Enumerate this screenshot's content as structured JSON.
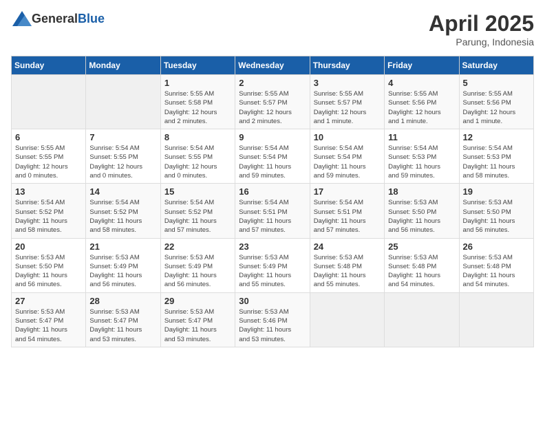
{
  "header": {
    "logo_general": "General",
    "logo_blue": "Blue",
    "title": "April 2025",
    "subtitle": "Parung, Indonesia"
  },
  "days_of_week": [
    "Sunday",
    "Monday",
    "Tuesday",
    "Wednesday",
    "Thursday",
    "Friday",
    "Saturday"
  ],
  "weeks": [
    [
      {
        "day": "",
        "detail": ""
      },
      {
        "day": "",
        "detail": ""
      },
      {
        "day": "1",
        "detail": "Sunrise: 5:55 AM\nSunset: 5:58 PM\nDaylight: 12 hours\nand 2 minutes."
      },
      {
        "day": "2",
        "detail": "Sunrise: 5:55 AM\nSunset: 5:57 PM\nDaylight: 12 hours\nand 2 minutes."
      },
      {
        "day": "3",
        "detail": "Sunrise: 5:55 AM\nSunset: 5:57 PM\nDaylight: 12 hours\nand 1 minute."
      },
      {
        "day": "4",
        "detail": "Sunrise: 5:55 AM\nSunset: 5:56 PM\nDaylight: 12 hours\nand 1 minute."
      },
      {
        "day": "5",
        "detail": "Sunrise: 5:55 AM\nSunset: 5:56 PM\nDaylight: 12 hours\nand 1 minute."
      }
    ],
    [
      {
        "day": "6",
        "detail": "Sunrise: 5:55 AM\nSunset: 5:55 PM\nDaylight: 12 hours\nand 0 minutes."
      },
      {
        "day": "7",
        "detail": "Sunrise: 5:54 AM\nSunset: 5:55 PM\nDaylight: 12 hours\nand 0 minutes."
      },
      {
        "day": "8",
        "detail": "Sunrise: 5:54 AM\nSunset: 5:55 PM\nDaylight: 12 hours\nand 0 minutes."
      },
      {
        "day": "9",
        "detail": "Sunrise: 5:54 AM\nSunset: 5:54 PM\nDaylight: 11 hours\nand 59 minutes."
      },
      {
        "day": "10",
        "detail": "Sunrise: 5:54 AM\nSunset: 5:54 PM\nDaylight: 11 hours\nand 59 minutes."
      },
      {
        "day": "11",
        "detail": "Sunrise: 5:54 AM\nSunset: 5:53 PM\nDaylight: 11 hours\nand 59 minutes."
      },
      {
        "day": "12",
        "detail": "Sunrise: 5:54 AM\nSunset: 5:53 PM\nDaylight: 11 hours\nand 58 minutes."
      }
    ],
    [
      {
        "day": "13",
        "detail": "Sunrise: 5:54 AM\nSunset: 5:52 PM\nDaylight: 11 hours\nand 58 minutes."
      },
      {
        "day": "14",
        "detail": "Sunrise: 5:54 AM\nSunset: 5:52 PM\nDaylight: 11 hours\nand 58 minutes."
      },
      {
        "day": "15",
        "detail": "Sunrise: 5:54 AM\nSunset: 5:52 PM\nDaylight: 11 hours\nand 57 minutes."
      },
      {
        "day": "16",
        "detail": "Sunrise: 5:54 AM\nSunset: 5:51 PM\nDaylight: 11 hours\nand 57 minutes."
      },
      {
        "day": "17",
        "detail": "Sunrise: 5:54 AM\nSunset: 5:51 PM\nDaylight: 11 hours\nand 57 minutes."
      },
      {
        "day": "18",
        "detail": "Sunrise: 5:53 AM\nSunset: 5:50 PM\nDaylight: 11 hours\nand 56 minutes."
      },
      {
        "day": "19",
        "detail": "Sunrise: 5:53 AM\nSunset: 5:50 PM\nDaylight: 11 hours\nand 56 minutes."
      }
    ],
    [
      {
        "day": "20",
        "detail": "Sunrise: 5:53 AM\nSunset: 5:50 PM\nDaylight: 11 hours\nand 56 minutes."
      },
      {
        "day": "21",
        "detail": "Sunrise: 5:53 AM\nSunset: 5:49 PM\nDaylight: 11 hours\nand 56 minutes."
      },
      {
        "day": "22",
        "detail": "Sunrise: 5:53 AM\nSunset: 5:49 PM\nDaylight: 11 hours\nand 56 minutes."
      },
      {
        "day": "23",
        "detail": "Sunrise: 5:53 AM\nSunset: 5:49 PM\nDaylight: 11 hours\nand 55 minutes."
      },
      {
        "day": "24",
        "detail": "Sunrise: 5:53 AM\nSunset: 5:48 PM\nDaylight: 11 hours\nand 55 minutes."
      },
      {
        "day": "25",
        "detail": "Sunrise: 5:53 AM\nSunset: 5:48 PM\nDaylight: 11 hours\nand 54 minutes."
      },
      {
        "day": "26",
        "detail": "Sunrise: 5:53 AM\nSunset: 5:48 PM\nDaylight: 11 hours\nand 54 minutes."
      }
    ],
    [
      {
        "day": "27",
        "detail": "Sunrise: 5:53 AM\nSunset: 5:47 PM\nDaylight: 11 hours\nand 54 minutes."
      },
      {
        "day": "28",
        "detail": "Sunrise: 5:53 AM\nSunset: 5:47 PM\nDaylight: 11 hours\nand 53 minutes."
      },
      {
        "day": "29",
        "detail": "Sunrise: 5:53 AM\nSunset: 5:47 PM\nDaylight: 11 hours\nand 53 minutes."
      },
      {
        "day": "30",
        "detail": "Sunrise: 5:53 AM\nSunset: 5:46 PM\nDaylight: 11 hours\nand 53 minutes."
      },
      {
        "day": "",
        "detail": ""
      },
      {
        "day": "",
        "detail": ""
      },
      {
        "day": "",
        "detail": ""
      }
    ]
  ]
}
